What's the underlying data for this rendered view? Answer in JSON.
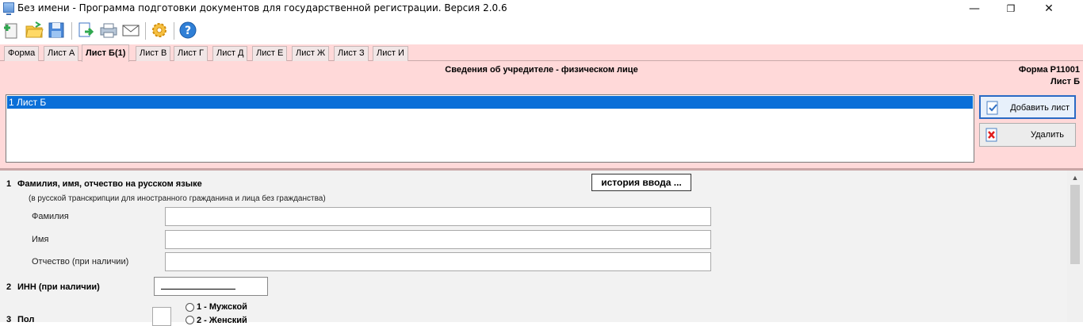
{
  "window": {
    "title": "Без имени - Программа подготовки документов для государственной регистрации. Версия 2.0.6",
    "minimize_glyph": "—",
    "maximize_glyph": "❐",
    "close_glyph": "✕"
  },
  "toolbar": {
    "icons": [
      "new-document-icon",
      "open-folder-icon",
      "save-icon",
      "export-icon",
      "print-icon",
      "email-icon",
      "settings-gear-icon",
      "help-icon"
    ]
  },
  "tabs": [
    "Форма",
    "Лист А",
    "Лист Б(1)",
    "Лист В",
    "Лист Г",
    "Лист Д",
    "Лист Е",
    "Лист Ж",
    "Лист З",
    "Лист И"
  ],
  "active_tab": "Лист Б(1)",
  "panel": {
    "title": "Сведения об учредителе - физическом лице",
    "form_code": "Форма Р11001",
    "sheet_code": "Лист Б",
    "list_items": [
      "1 Лист Б"
    ],
    "add_label": "Добавить лист",
    "delete_label": "Удалить"
  },
  "form": {
    "q1_number": "1",
    "q1_title": "Фамилия, имя, отчество на русском языке",
    "q1_note": "(в русской транскрипции для иностранного гражданина и лица без гражданства)",
    "history_label": "история ввода ...",
    "surname_label": "Фамилия",
    "name_label": "Имя",
    "patronymic_label": "Отчество (при наличии)",
    "surname_value": "",
    "name_value": "",
    "patronymic_value": "",
    "q2_number": "2",
    "q2_title": "ИНН (при наличии)",
    "q3_number": "3",
    "q3_title": "Пол",
    "sex_male": "1 - Мужской",
    "sex_female": "2 - Женский"
  },
  "colors": {
    "panel_bg": "#ffd9d9",
    "selection": "#0a6fd8"
  }
}
